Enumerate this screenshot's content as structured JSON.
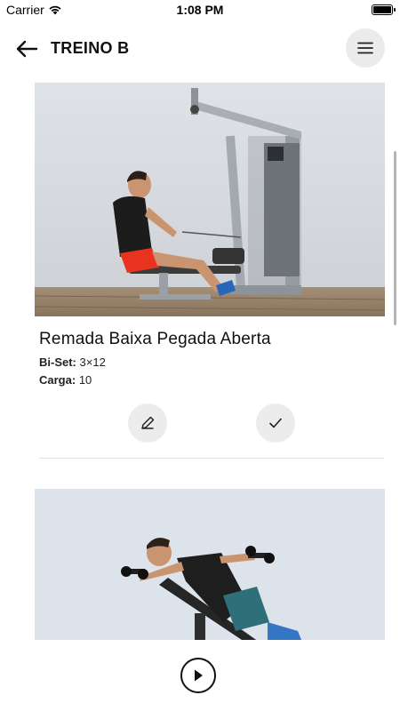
{
  "status_bar": {
    "carrier": "Carrier",
    "time": "1:08 PM"
  },
  "header": {
    "title": "TREINO B",
    "back_icon": "arrow-left-icon",
    "menu_icon": "hamburger-menu-icon"
  },
  "exercises": [
    {
      "name": "Remada Baixa Pegada Aberta",
      "biset_label": "Bi-Set:",
      "biset_value": "3×12",
      "carga_label": "Carga:",
      "carga_value": "10",
      "edit_icon": "pencil-icon",
      "done_icon": "check-icon"
    },
    {
      "name": "",
      "image": "man-on-incline-bench-with-dumbbells"
    }
  ],
  "bottom": {
    "play_icon": "play-icon"
  }
}
